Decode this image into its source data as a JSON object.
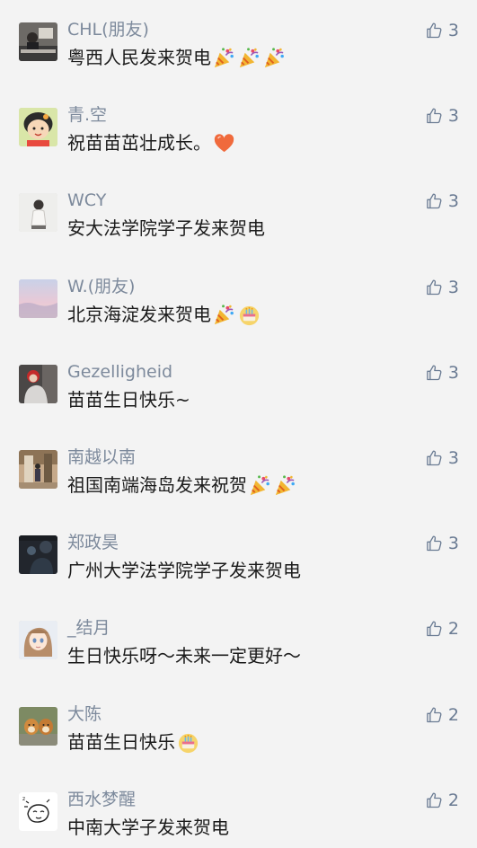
{
  "comments": [
    {
      "nickname": "CHL(朋友)",
      "text": "粤西人民发来贺电",
      "emojis": [
        "party-popper-icon",
        "party-popper-icon",
        "party-popper-icon"
      ],
      "likes": "3",
      "avatar": "photo-desk"
    },
    {
      "nickname": "青.空",
      "text": "祝苗苗茁壮成长。",
      "emojis": [
        "heart-icon"
      ],
      "likes": "3",
      "avatar": "cartoon-girl"
    },
    {
      "nickname": "WCY",
      "text": "安大法学院学子发来贺电",
      "emojis": [],
      "likes": "3",
      "avatar": "person-light"
    },
    {
      "nickname": "W.(朋友)",
      "text": "北京海淀发来贺电",
      "emojis": [
        "party-popper-icon",
        "cake-icon"
      ],
      "likes": "3",
      "avatar": "sky-pink"
    },
    {
      "nickname": "Gezelligheid",
      "text": "苗苗生日快乐~",
      "emojis": [],
      "likes": "3",
      "avatar": "person-red"
    },
    {
      "nickname": "南越以南",
      "text": "祖国南端海岛发来祝贺",
      "emojis": [
        "party-popper-icon",
        "party-popper-icon"
      ],
      "likes": "3",
      "avatar": "street-photo"
    },
    {
      "nickname": "郑政昊",
      "text": "广州大学法学院学子发来贺电",
      "emojis": [],
      "likes": "3",
      "avatar": "dark-photo"
    },
    {
      "nickname": "_结月",
      "text": "生日快乐呀～未来一定更好～",
      "emojis": [],
      "likes": "2",
      "avatar": "anime-girl"
    },
    {
      "nickname": "大陈",
      "text": "苗苗生日快乐",
      "emojis": [
        "cake-icon"
      ],
      "likes": "2",
      "avatar": "dogs"
    },
    {
      "nickname": "西水梦醒",
      "text": "中南大学子发来贺电",
      "emojis": [],
      "likes": "2",
      "avatar": "sketch"
    }
  ],
  "colors": {
    "background": "#f3f3f3",
    "nickname": "#7d8a9c",
    "content": "#1b1b1b",
    "like": "#6a7b93"
  }
}
